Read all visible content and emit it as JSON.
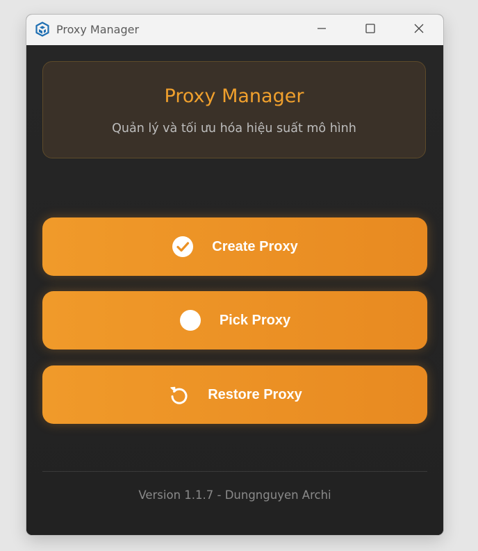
{
  "window": {
    "title": "Proxy Manager",
    "app_icon": "sketchup-logo-icon",
    "controls": [
      "minimize-icon",
      "maximize-icon",
      "close-icon"
    ]
  },
  "header": {
    "title": "Proxy Manager",
    "subtitle": "Quản lý và tối ưu hóa hiệu suất mô hình"
  },
  "actions": [
    {
      "label": "Create Proxy",
      "icon": "check-circle-icon"
    },
    {
      "label": "Pick Proxy",
      "icon": "circle-icon"
    },
    {
      "label": "Restore Proxy",
      "icon": "restore-icon"
    }
  ],
  "footer": {
    "text": "Version 1.1.7 - Dungnguyen Archi"
  },
  "colors": {
    "accent": "#f09a2a",
    "title_accent": "#f0a02d",
    "background": "#232323",
    "header_card": "#3a3128",
    "header_border": "#5d4a2a"
  }
}
